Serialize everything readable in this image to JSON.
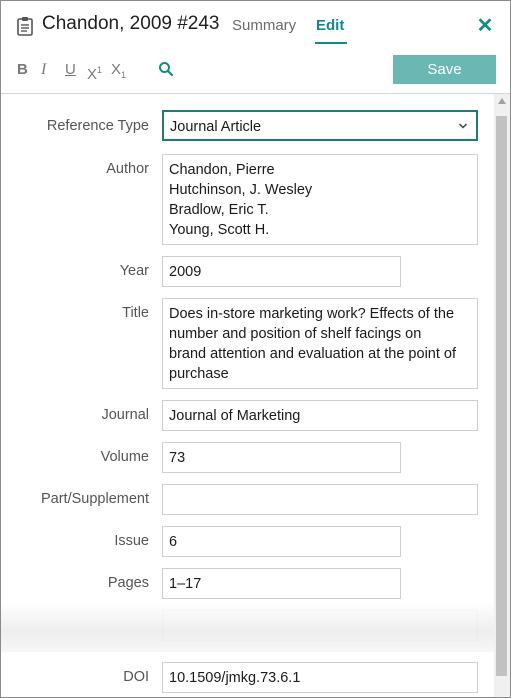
{
  "header": {
    "title": "Chandon, 2009 #243",
    "tabs": {
      "summary": "Summary",
      "edit": "Edit"
    },
    "close_label": "✕"
  },
  "toolbar": {
    "bold": "B",
    "italic": "I",
    "underline": "U",
    "superscript_base": "X",
    "superscript_mark": "1",
    "subscript_base": "X",
    "subscript_mark": "1",
    "save_label": "Save"
  },
  "fields": {
    "reference_type": {
      "label": "Reference Type",
      "value": "Journal Article"
    },
    "author": {
      "label": "Author",
      "lines": [
        "Chandon, Pierre",
        "Hutchinson, J. Wesley",
        "Bradlow, Eric T.",
        "Young, Scott H."
      ]
    },
    "year": {
      "label": "Year",
      "value": "2009"
    },
    "title": {
      "label": "Title",
      "lines": [
        "Does in-store marketing work? Effects of the",
        "number and position of shelf facings on",
        "brand attention and evaluation at the point of",
        "purchase"
      ]
    },
    "journal": {
      "label": "Journal",
      "value": "Journal of Marketing"
    },
    "volume": {
      "label": "Volume",
      "value": "73"
    },
    "part_supplement": {
      "label": "Part/Supplement",
      "value": ""
    },
    "issue": {
      "label": "Issue",
      "value": "6"
    },
    "pages": {
      "label": "Pages",
      "value": "1–17"
    },
    "doi": {
      "label": "DOI",
      "value": "10.1509/jmkg.73.6.1"
    }
  },
  "colors": {
    "accent": "#138a8a",
    "save_button": "#6ab7b3"
  }
}
